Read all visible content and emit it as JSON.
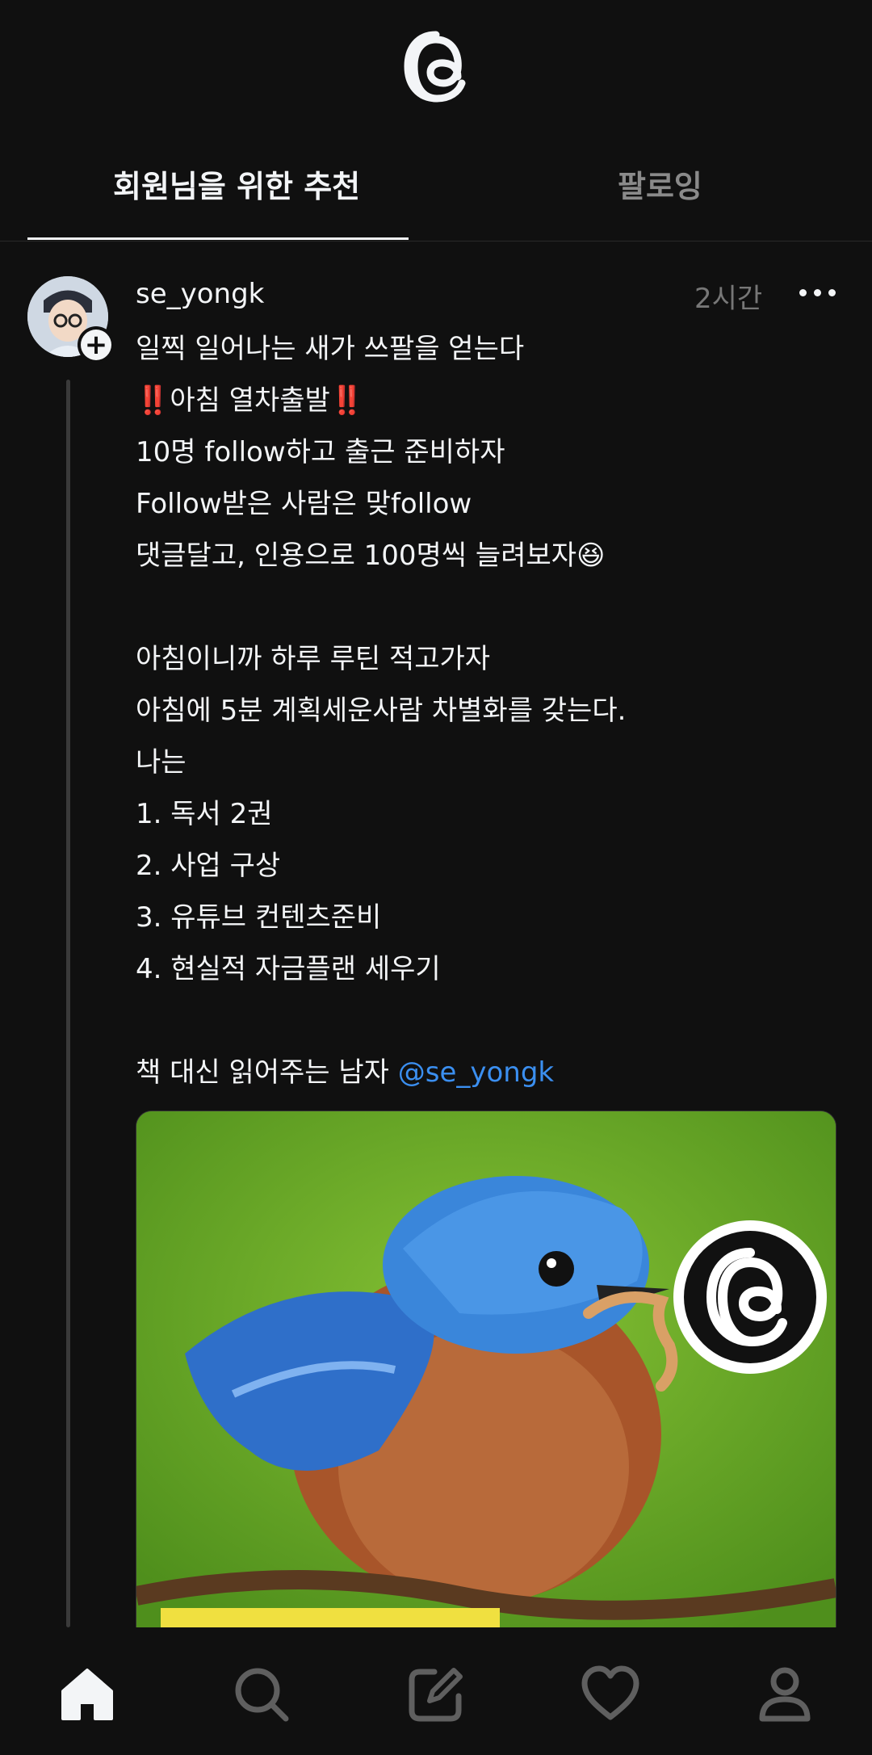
{
  "header": {
    "logo_icon": "threads-logo-icon"
  },
  "tabs": [
    {
      "label": "회원님을 위한 추천",
      "active": true
    },
    {
      "label": "팔로잉",
      "active": false
    }
  ],
  "post": {
    "username": "se_yongk",
    "time": "2시간",
    "lines": [
      "일찍 일어나는 새가 쓰팔을 얻는다",
      "‼️아침 열차출발‼️",
      "10명 follow하고 출근 준비하자",
      "Follow받은 사람은 맞follow",
      "댓글달고, 인용으로 100명씩 늘려보자😆",
      "",
      "아침이니까 하루 루틴 적고가자",
      "아침에 5분 계획세운사람 차별화를 갖는다.",
      "나는",
      "1. 독서 2권",
      "2. 사업 구상",
      "3. 유튜브 컨텐츠준비",
      "4. 현실적 자금플랜 세우기",
      ""
    ],
    "last_line_text": "책 대신 읽어주는 남자 ",
    "mention": "@se_yongk",
    "image_icon": "bluebird-eating-worm-image"
  },
  "bottom_nav": [
    "home-icon",
    "search-icon",
    "compose-icon",
    "heart-icon",
    "profile-icon"
  ],
  "colors": {
    "background": "#101010",
    "text": "#f3f5f7",
    "mention": "#3b8ff0",
    "muted": "#777777"
  }
}
